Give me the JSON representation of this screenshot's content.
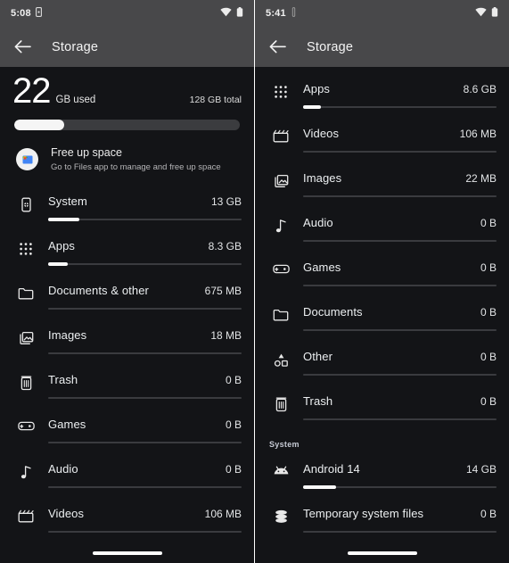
{
  "colors": {
    "appbar_bg": "#48484a",
    "content_bg": "#131417",
    "accent_text": "#ffffff",
    "bar_fill": "#fafafa",
    "bar_track": "#3a3b3f",
    "section_label": "#c6cad4"
  },
  "left": {
    "status": {
      "time": "5:08",
      "battery_icon": "battery-icon",
      "wifi_icon": "wifi-icon",
      "extra_icon": "device-icon"
    },
    "appbar": {
      "back_icon": "back-arrow-icon",
      "title": "Storage"
    },
    "summary": {
      "used_number": "22",
      "used_unit": "GB used",
      "total": "128 GB total",
      "bar_percent": 22
    },
    "freeup": {
      "icon": "files-app-icon",
      "title": "Free up space",
      "subtitle": "Go to Files app to manage and free up space"
    },
    "items": [
      {
        "icon": "phone-system-icon",
        "label": "System",
        "value": "13 GB",
        "bar_percent": 16,
        "has_bar": true
      },
      {
        "icon": "apps-grid-icon",
        "label": "Apps",
        "value": "8.3 GB",
        "bar_percent": 10,
        "has_bar": true
      },
      {
        "icon": "folder-icon",
        "label": "Documents & other",
        "value": "675 MB",
        "bar_percent": 0,
        "has_bar": true
      },
      {
        "icon": "image-icon",
        "label": "Images",
        "value": "18 MB",
        "bar_percent": 0,
        "has_bar": true
      },
      {
        "icon": "trash-icon",
        "label": "Trash",
        "value": "0 B",
        "bar_percent": 0,
        "has_bar": true
      },
      {
        "icon": "gamepad-icon",
        "label": "Games",
        "value": "0 B",
        "bar_percent": 0,
        "has_bar": true
      },
      {
        "icon": "music-note-icon",
        "label": "Audio",
        "value": "0 B",
        "bar_percent": 0,
        "has_bar": true
      },
      {
        "icon": "video-icon",
        "label": "Videos",
        "value": "106 MB",
        "bar_percent": 0,
        "has_bar": true
      }
    ]
  },
  "right": {
    "status": {
      "time": "5:41",
      "battery_icon": "battery-icon",
      "wifi_icon": "wifi-icon",
      "extra_icon": "device-icon"
    },
    "appbar": {
      "back_icon": "back-arrow-icon",
      "title": "Storage"
    },
    "items": [
      {
        "icon": "apps-grid-icon",
        "label": "Apps",
        "value": "8.6 GB",
        "bar_percent": 9,
        "has_bar": true
      },
      {
        "icon": "video-icon",
        "label": "Videos",
        "value": "106 MB",
        "bar_percent": 0,
        "has_bar": true
      },
      {
        "icon": "image-icon",
        "label": "Images",
        "value": "22 MB",
        "bar_percent": 0,
        "has_bar": true
      },
      {
        "icon": "music-note-icon",
        "label": "Audio",
        "value": "0 B",
        "bar_percent": 0,
        "has_bar": true
      },
      {
        "icon": "gamepad-icon",
        "label": "Games",
        "value": "0 B",
        "bar_percent": 0,
        "has_bar": true
      },
      {
        "icon": "folder-icon",
        "label": "Documents",
        "value": "0 B",
        "bar_percent": 0,
        "has_bar": true
      },
      {
        "icon": "shapes-icon",
        "label": "Other",
        "value": "0 B",
        "bar_percent": 0,
        "has_bar": true
      },
      {
        "icon": "trash-icon",
        "label": "Trash",
        "value": "0 B",
        "bar_percent": 0,
        "has_bar": true
      }
    ],
    "section": {
      "label": "System"
    },
    "system_items": [
      {
        "icon": "android-icon",
        "label": "Android 14",
        "value": "14 GB",
        "bar_percent": 17,
        "has_bar": true
      },
      {
        "icon": "database-icon",
        "label": "Temporary system files",
        "value": "0 B",
        "bar_percent": 0,
        "has_bar": true
      }
    ]
  }
}
